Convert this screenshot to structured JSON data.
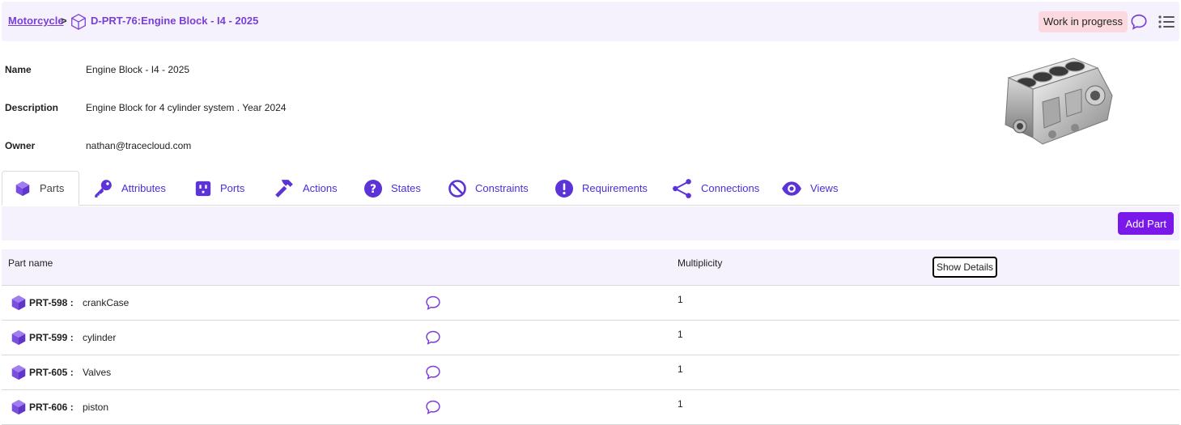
{
  "breadcrumb": {
    "parent": "Motorcycle",
    "separator": ">",
    "title": "D-PRT-76:Engine Block - I4 - 2025"
  },
  "status": "Work in progress",
  "info": {
    "name_label": "Name",
    "name_value": "Engine Block - I4 - 2025",
    "description_label": "Description",
    "description_value": "Engine Block for 4 cylinder system . Year 2024",
    "owner_label": "Owner",
    "owner_value": "nathan@tracecloud.com"
  },
  "tabs": [
    {
      "label": "Parts",
      "icon": "cube-icon",
      "active": true
    },
    {
      "label": "Attributes",
      "icon": "key-icon"
    },
    {
      "label": "Ports",
      "icon": "port-icon"
    },
    {
      "label": "Actions",
      "icon": "hammer-icon"
    },
    {
      "label": "States",
      "icon": "question-icon"
    },
    {
      "label": "Constraints",
      "icon": "ban-icon"
    },
    {
      "label": "Requirements",
      "icon": "exclamation-icon"
    },
    {
      "label": "Connections",
      "icon": "share-nodes-icon"
    },
    {
      "label": "Views",
      "icon": "eye-icon"
    }
  ],
  "toolbar": {
    "add_label": "Add Part"
  },
  "table": {
    "col_name": "Part name",
    "col_multiplicity": "Multiplicity",
    "show_details": "Show Details",
    "rows": [
      {
        "id": "PRT-598 :",
        "name": "crankCase",
        "multiplicity": "1"
      },
      {
        "id": "PRT-599 :",
        "name": "cylinder",
        "multiplicity": "1"
      },
      {
        "id": "PRT-605 :",
        "name": "Valves",
        "multiplicity": "1"
      },
      {
        "id": "PRT-606 :",
        "name": "piston",
        "multiplicity": "1"
      }
    ]
  },
  "colors": {
    "accent": "#7a18ea",
    "link": "#4a2fd6",
    "header_bg": "#f5f1fd",
    "badge_bg": "#fbd9de"
  }
}
